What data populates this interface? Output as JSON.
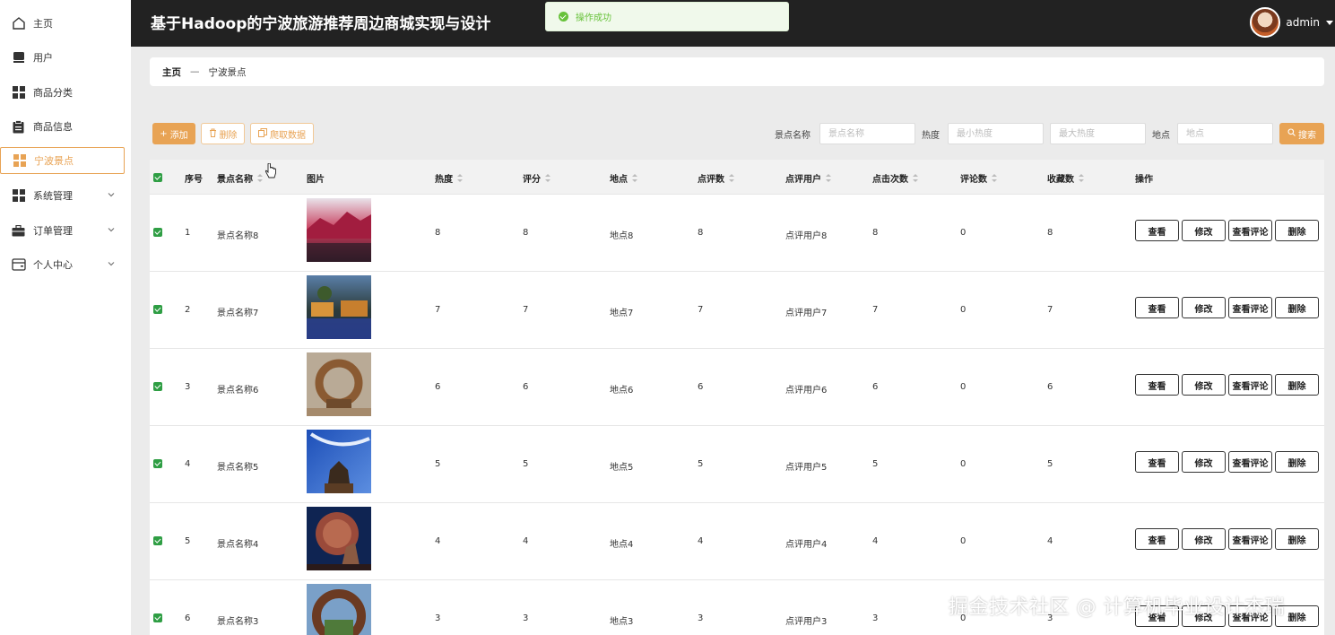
{
  "sidebar": {
    "items": [
      {
        "label": "主页",
        "icon": "home-icon"
      },
      {
        "label": "用户",
        "icon": "user-icon"
      },
      {
        "label": "商品分类",
        "icon": "grid-icon"
      },
      {
        "label": "商品信息",
        "icon": "clipboard-icon"
      },
      {
        "label": "宁波景点",
        "icon": "grid-icon",
        "active": true
      },
      {
        "label": "系统管理",
        "icon": "grid-icon",
        "expandable": true
      },
      {
        "label": "订单管理",
        "icon": "briefcase-icon",
        "expandable": true
      },
      {
        "label": "个人中心",
        "icon": "wallet-icon",
        "expandable": true
      }
    ]
  },
  "header": {
    "title": "基于Hadoop的宁波旅游推荐周边商城实现与设计",
    "user": "admin"
  },
  "toast": {
    "text": "操作成功"
  },
  "breadcrumb": {
    "home": "主页",
    "separator": "—",
    "current": "宁波景点"
  },
  "toolbar": {
    "add_label": "添加",
    "delete_label": "删除",
    "crawl_label": "爬取数据",
    "search_label": "搜索",
    "filters": {
      "name_label": "景点名称",
      "name_placeholder": "景点名称",
      "heat_label": "热度",
      "heat_min_placeholder": "最小热度",
      "heat_max_placeholder": "最大热度",
      "location_label": "地点",
      "location_placeholder": "地点"
    }
  },
  "table": {
    "columns": [
      "序号",
      "景点名称",
      "图片",
      "热度",
      "评分",
      "地点",
      "点评数",
      "点评用户",
      "点击次数",
      "评论数",
      "收藏数",
      "操作"
    ],
    "actions": [
      "查看",
      "修改",
      "查看评论",
      "删除"
    ],
    "rows": [
      {
        "no": "1",
        "name": "景点名称8",
        "heat": "8",
        "score": "8",
        "location": "地点8",
        "reviews": "8",
        "reviewer": "点评用户8",
        "clicks": "8",
        "comments": "0",
        "favorites": "8"
      },
      {
        "no": "2",
        "name": "景点名称7",
        "heat": "7",
        "score": "7",
        "location": "地点7",
        "reviews": "7",
        "reviewer": "点评用户7",
        "clicks": "7",
        "comments": "0",
        "favorites": "7"
      },
      {
        "no": "3",
        "name": "景点名称6",
        "heat": "6",
        "score": "6",
        "location": "地点6",
        "reviews": "6",
        "reviewer": "点评用户6",
        "clicks": "6",
        "comments": "0",
        "favorites": "6"
      },
      {
        "no": "4",
        "name": "景点名称5",
        "heat": "5",
        "score": "5",
        "location": "地点5",
        "reviews": "5",
        "reviewer": "点评用户5",
        "clicks": "5",
        "comments": "0",
        "favorites": "5"
      },
      {
        "no": "5",
        "name": "景点名称4",
        "heat": "4",
        "score": "4",
        "location": "地点4",
        "reviews": "4",
        "reviewer": "点评用户4",
        "clicks": "4",
        "comments": "0",
        "favorites": "4"
      },
      {
        "no": "6",
        "name": "景点名称3",
        "heat": "3",
        "score": "3",
        "location": "地点3",
        "reviews": "3",
        "reviewer": "点评用户3",
        "clicks": "3",
        "comments": "0",
        "favorites": "3"
      }
    ]
  },
  "watermark": "掘金技术社区 @ 计算机毕业设计杰瑞",
  "colors": {
    "accent": "#e8a354",
    "header_bg": "#222222",
    "success": "#67c23a",
    "checkbox": "#2f9e44"
  }
}
